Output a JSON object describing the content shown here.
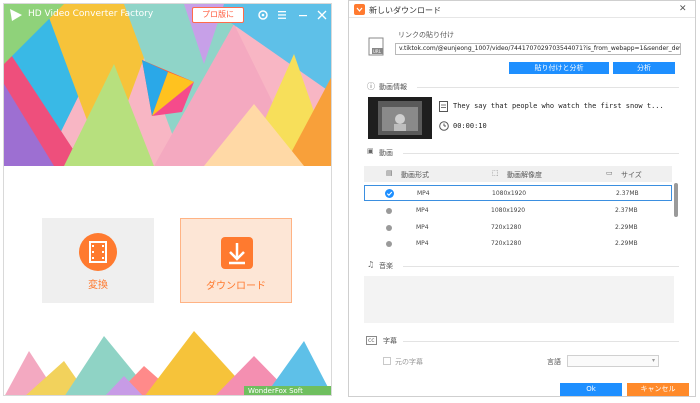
{
  "left_window": {
    "app_title": "HD Video Converter Factory",
    "pro_button": "プロ版に",
    "convert_label": "変換",
    "download_label": "ダウンロード",
    "brand": "WonderFox Soft",
    "colors": {
      "accent": "#ff7a2f",
      "card_bg": "#efefef",
      "selected_card_bg": "#fde6d6"
    }
  },
  "dialog": {
    "title": "新しいダウンロード",
    "paste_label": "リンクの貼り付け",
    "url_value": "v.tiktok.com/@eunjeong_1007/video/7441707029703544071?is_from_webapp=1&sender_device=pc",
    "paste_analyze_button": "貼り付けと分析",
    "analyze_button": "分析",
    "info_section": "動画情報",
    "video_title": "They say that people who watch the first snow t...",
    "duration": "00:00:10",
    "video_section": "動画",
    "columns": {
      "format": "動画形式",
      "resolution": "動画解像度",
      "size": "サイズ"
    },
    "rows": [
      {
        "format": "MP4",
        "resolution": "1080x1920",
        "size": "2.37MB",
        "selected": true
      },
      {
        "format": "MP4",
        "resolution": "1080x1920",
        "size": "2.37MB",
        "selected": false
      },
      {
        "format": "MP4",
        "resolution": "720x1280",
        "size": "2.29MB",
        "selected": false
      },
      {
        "format": "MP4",
        "resolution": "720x1280",
        "size": "2.29MB",
        "selected": false
      }
    ],
    "audio_section": "音楽",
    "subtitle_section": "字幕",
    "original_subtitle": "元の字幕",
    "language_label": "言語",
    "ok_button": "Ok",
    "cancel_button": "キャンセル",
    "colors": {
      "primary": "#1e8fff",
      "cancel": "#ff8a2a",
      "url_text": "#222222"
    }
  }
}
